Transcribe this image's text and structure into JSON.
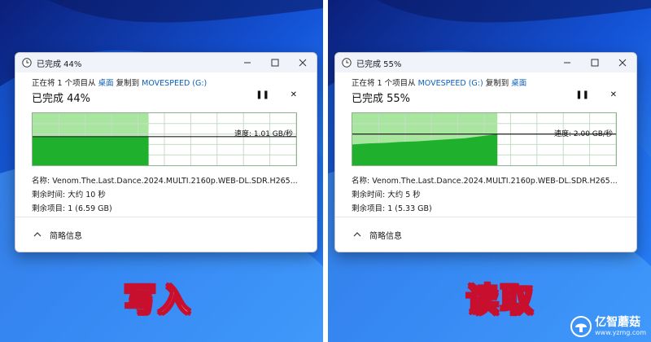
{
  "colors": {
    "fill_light": "#a8e6a0",
    "fill_dark": "#1fb02e",
    "link": "#0a5fbf",
    "caption_outline": "#c8102e"
  },
  "panels": [
    {
      "window_title": "已完成 44%",
      "line1_pre": "正在将 1 个项目从 ",
      "source": "桌面",
      "line1_mid": " 复制到 ",
      "dest": "MOVESPEED (G:)",
      "progress_text": "已完成 44%",
      "progress": 0.44,
      "speed_text": "速度: 1.01 GB/秒",
      "name_line": "名称: Venom.The.Last.Dance.2024.MULTI.2160p.WEB-DL.SDR.H265...",
      "time_line": "剩余时间: 大约 10 秒",
      "items_line": "剩余项目: 1 (6.59 GB)",
      "footer_label": "简略信息",
      "caption": "写入",
      "speed_profile": [
        0.55,
        0.55,
        0.55,
        0.55,
        0.55,
        0.55,
        0.55,
        0.55,
        0.55,
        0.55
      ]
    },
    {
      "window_title": "已完成 55%",
      "line1_pre": "正在将 1 个项目从 ",
      "source": "MOVESPEED (G:)",
      "line1_mid": " 复制到 ",
      "dest": "桌面",
      "progress_text": "已完成 55%",
      "progress": 0.55,
      "speed_text": "速度: 2.00 GB/秒",
      "name_line": "名称: Venom.The.Last.Dance.2024.MULTI.2160p.WEB-DL.SDR.H265...",
      "time_line": "剩余时间: 大约 5 秒",
      "items_line": "剩余项目: 1 (5.33 GB)",
      "footer_label": "简略信息",
      "caption": "读取",
      "speed_profile": [
        0.4,
        0.42,
        0.43,
        0.45,
        0.46,
        0.48,
        0.5,
        0.52,
        0.56,
        0.6
      ]
    }
  ],
  "watermark": {
    "name": "亿智蘑菇",
    "url": "www.yzmg.com"
  },
  "icons": {
    "title": "clock-icon",
    "minimize": "minimize-icon",
    "maximize": "maximize-icon",
    "close": "close-icon",
    "pause": "pause-icon",
    "cancel": "cancel-icon",
    "chevron": "chevron-up-icon",
    "watermark_logo": "mushroom-logo-icon"
  }
}
